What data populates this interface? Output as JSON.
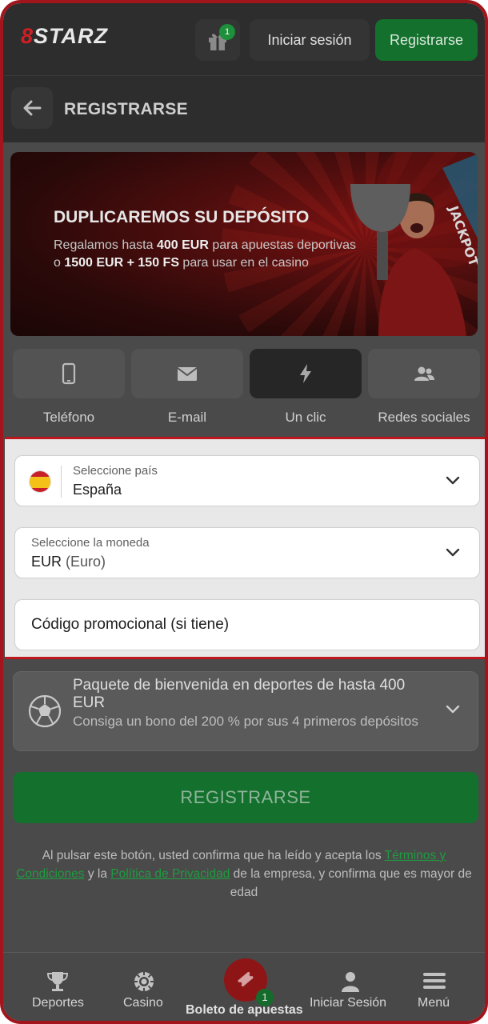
{
  "header": {
    "logo_prefix": "8",
    "logo_text": "STARZ",
    "gift_badge": "1",
    "login_label": "Iniciar sesión",
    "register_label": "Registrarse"
  },
  "subheader": {
    "title": "REGISTRARSE"
  },
  "banner": {
    "title": "DUPLICAREMOS SU DEPÓSITO",
    "line1_pre": "Regalamos hasta ",
    "line1_bold": "400 EUR",
    "line1_post": " para apuestas deportivas",
    "line2_pre": "o ",
    "line2_bold": "1500 EUR + 150 FS",
    "line2_post": " para usar en el casino"
  },
  "methods": [
    {
      "label": "Teléfono",
      "icon": "phone-icon",
      "active": false
    },
    {
      "label": "E-mail",
      "icon": "envelope-icon",
      "active": false
    },
    {
      "label": "Un clic",
      "icon": "lightning-icon",
      "active": true
    },
    {
      "label": "Redes sociales",
      "icon": "people-icon",
      "active": false
    }
  ],
  "form": {
    "country_label": "Seleccione país",
    "country_value": "España",
    "currency_label": "Seleccione la moneda",
    "currency_code": "EUR",
    "currency_name": "(Euro)",
    "promo_placeholder": "Código promocional (si tiene)"
  },
  "bonus": {
    "title": "Paquete de bienvenida en deportes de hasta 400 EUR",
    "subtitle": "Consiga un bono del 200 % por sus 4 primeros depósitos"
  },
  "register_button": "REGISTRARSE",
  "legal": {
    "text_1": "Al pulsar este botón, usted confirma que ha leído y acepta los ",
    "link_terms": "Términos y Condiciones",
    "text_2": " y la ",
    "link_privacy": "Política de Privacidad",
    "text_3": " de la empresa, y confirma que es mayor de edad"
  },
  "bottom_nav": {
    "sports": "Deportes",
    "casino": "Casino",
    "betslip": "Boleto de apuestas",
    "betslip_badge": "1",
    "login": "Iniciar Sesión",
    "menu": "Menú"
  },
  "colors": {
    "brand_red": "#c0161d",
    "brand_green": "#14702d",
    "link_green": "#1e9b3f"
  }
}
